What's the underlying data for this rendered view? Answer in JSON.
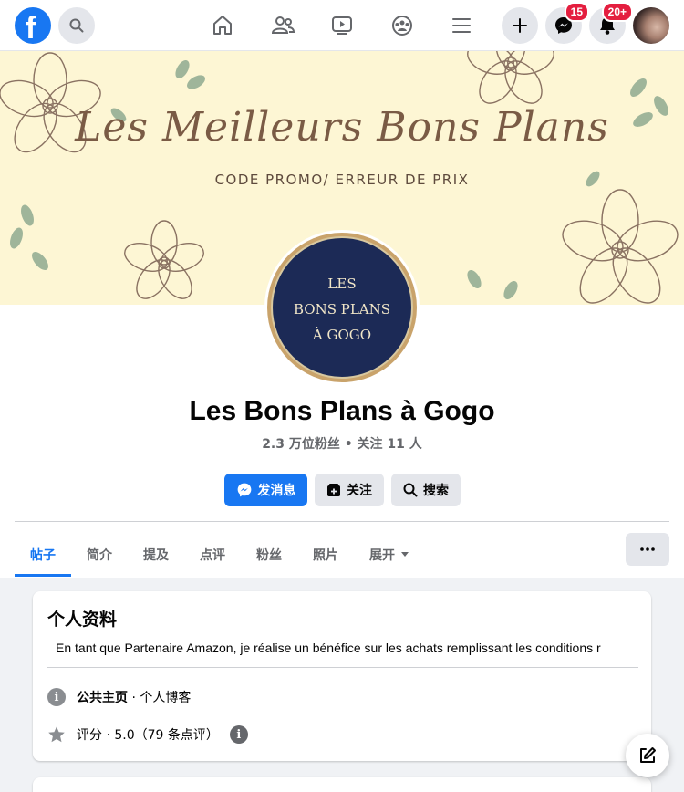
{
  "nav": {
    "logo_letter": "f",
    "messenger_badge": "15",
    "notifications_badge": "20+"
  },
  "cover": {
    "title": "Les Meilleurs Bons Plans",
    "subtitle": "CODE PROMO/ ERREUR DE PRIX"
  },
  "profile_picture": {
    "line1": "LES",
    "line2": "BONS PLANS",
    "line3": "À GOGO"
  },
  "page": {
    "name": "Les Bons Plans à Gogo",
    "stats": "2.3 万位粉丝 • 关注 11 人"
  },
  "actions": {
    "message_label": "发消息",
    "follow_label": "关注",
    "search_label": "搜索"
  },
  "tabs": [
    {
      "label": "帖子"
    },
    {
      "label": "简介"
    },
    {
      "label": "提及"
    },
    {
      "label": "点评"
    },
    {
      "label": "粉丝"
    },
    {
      "label": "照片"
    },
    {
      "label": "展开"
    }
  ],
  "intro": {
    "title": "个人资料",
    "description": "En tant que Partenaire Amazon, je réalise un bénéfice sur les achats remplissant les conditions r",
    "category_label": "公共主页",
    "category_value": " · 个人博客",
    "rating_text": "评分 · 5.0（79 条点评）"
  },
  "colors": {
    "brand": "#1877f2",
    "badge": "#e41e3f",
    "cover_bg": "#fdf6d4",
    "cover_text": "#7a5b45",
    "pp_navy": "#1c2a56"
  }
}
